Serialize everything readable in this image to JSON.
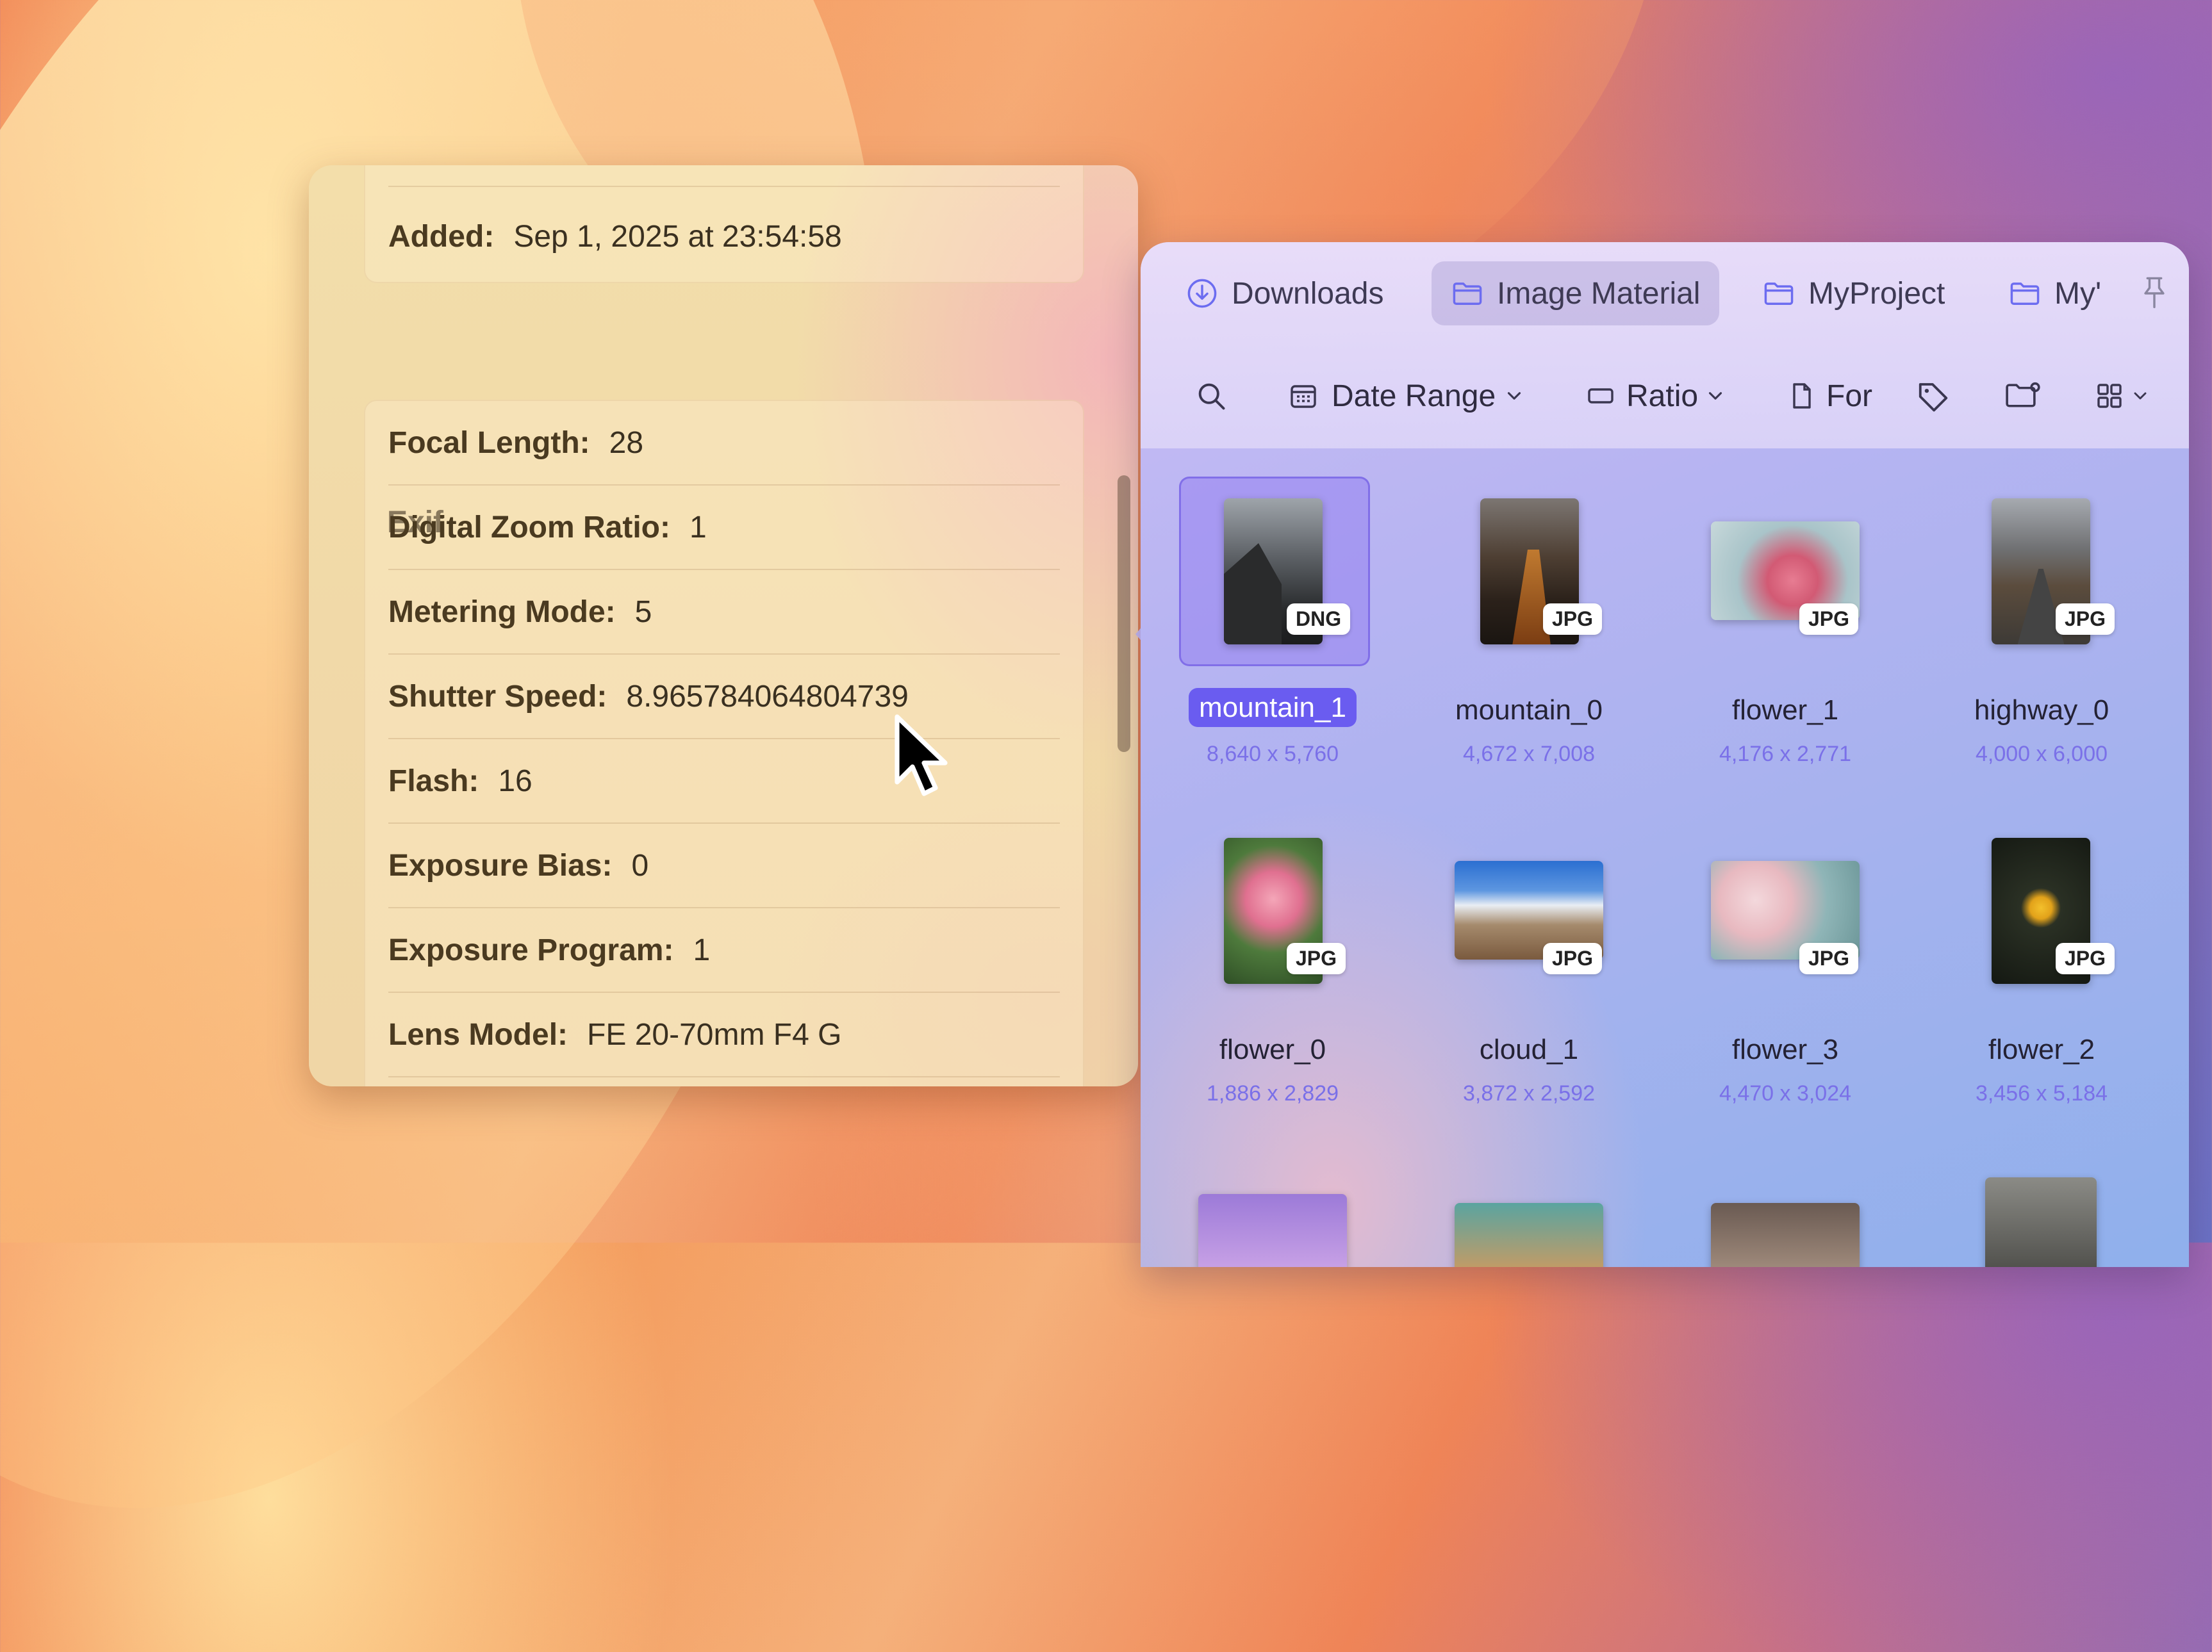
{
  "info_panel": {
    "added_label": "Added:",
    "added_value": "Sep 1, 2025 at 23:54:58",
    "exif_title": "Exif",
    "rows": [
      {
        "label": "Focal Length:",
        "value": "28"
      },
      {
        "label": "Digital Zoom Ratio:",
        "value": "1"
      },
      {
        "label": "Metering Mode:",
        "value": "5"
      },
      {
        "label": "Shutter Speed:",
        "value": "8.965784064804739"
      },
      {
        "label": "Flash:",
        "value": "16"
      },
      {
        "label": "Exposure Bias:",
        "value": "0"
      },
      {
        "label": "Exposure Program:",
        "value": "1"
      },
      {
        "label": "Lens Model:",
        "value": "FE 20-70mm F4 G"
      }
    ]
  },
  "browser": {
    "tabs": [
      {
        "label": "Downloads",
        "icon": "download-icon"
      },
      {
        "label": "Image Material",
        "icon": "folder-icon",
        "active": true
      },
      {
        "label": "MyProject",
        "icon": "folder-icon"
      },
      {
        "label": "My'",
        "icon": "folder-icon"
      }
    ],
    "toolbar": {
      "date_range": "Date Range",
      "ratio": "Ratio",
      "format": "For"
    },
    "files": [
      {
        "name": "mountain_1",
        "dims": "8,640 x 5,760",
        "format": "DNG",
        "selected": true
      },
      {
        "name": "mountain_0",
        "dims": "4,672 x 7,008",
        "format": "JPG"
      },
      {
        "name": "flower_1",
        "dims": "4,176 x 2,771",
        "format": "JPG"
      },
      {
        "name": "highway_0",
        "dims": "4,000 x 6,000",
        "format": "JPG"
      },
      {
        "name": "flower_0",
        "dims": "1,886 x 2,829",
        "format": "JPG"
      },
      {
        "name": "cloud_1",
        "dims": "3,872 x 2,592",
        "format": "JPG"
      },
      {
        "name": "flower_3",
        "dims": "4,470 x 3,024",
        "format": "JPG"
      },
      {
        "name": "flower_2",
        "dims": "3,456 x 5,184",
        "format": "JPG"
      }
    ]
  }
}
